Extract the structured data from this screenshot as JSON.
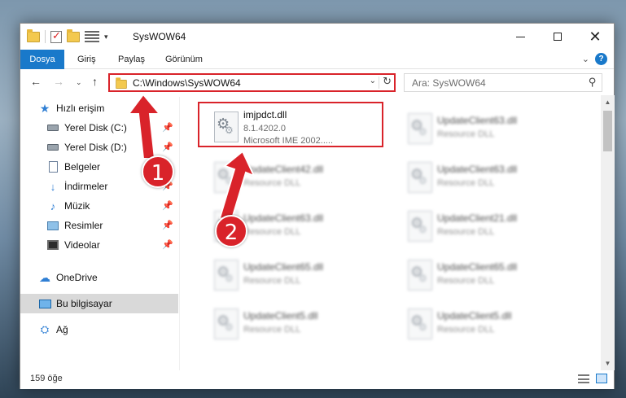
{
  "window": {
    "title": "SysWOW64",
    "minimize_icon": "minimize-icon",
    "maximize_icon": "maximize-icon",
    "close_icon": "close-icon",
    "close_glyph": "✕"
  },
  "ribbon": {
    "tabs": [
      {
        "label": "Dosya",
        "active": true
      },
      {
        "label": "Giriş"
      },
      {
        "label": "Paylaş"
      },
      {
        "label": "Görünüm"
      }
    ],
    "collapse_glyph": "⌄",
    "help_glyph": "?"
  },
  "nav": {
    "back_glyph": "←",
    "forward_glyph": "→",
    "history_glyph": "⌄",
    "up_glyph": "↑",
    "address": "C:\\Windows\\SysWOW64",
    "address_dropdown_glyph": "⌄",
    "refresh_glyph": "↻",
    "search_placeholder": "Ara: SysWOW64",
    "search_glyph": "⚲"
  },
  "sidebar": {
    "items": [
      {
        "label": "Hızlı erişim",
        "icon": "star-icon"
      },
      {
        "label": "Yerel Disk (C:)",
        "icon": "drive-icon",
        "pinned": true
      },
      {
        "label": "Yerel Disk (D:)",
        "icon": "drive-icon",
        "pinned": true
      },
      {
        "label": "Belgeler",
        "icon": "document-icon"
      },
      {
        "label": "İndirmeler",
        "icon": "download-icon",
        "pinned": true
      },
      {
        "label": "Müzik",
        "icon": "music-icon",
        "pinned": true
      },
      {
        "label": "Resimler",
        "icon": "pictures-icon",
        "pinned": true
      },
      {
        "label": "Videolar",
        "icon": "video-icon",
        "pinned": true
      },
      {
        "label": "OneDrive",
        "icon": "cloud-icon"
      },
      {
        "label": "Bu bilgisayar",
        "icon": "computer-icon",
        "selected": true
      },
      {
        "label": "Ağ",
        "icon": "network-icon"
      }
    ],
    "pin_glyph": "📌"
  },
  "files": [
    {
      "name": "imjpdct.dll",
      "version": "8.1.4202.0",
      "description": "Microsoft IME 2002.....",
      "highlighted": true
    },
    {
      "name": "UpdateClient63.dll",
      "type": "Resource DLL",
      "blurred": true
    },
    {
      "name": "UpdateClient42.dll",
      "type": "Resource DLL",
      "blurred": true
    },
    {
      "name": "UpdateClient63.dll",
      "type": "Resource DLL",
      "blurred": true
    },
    {
      "name": "UpdateClient63.dll",
      "type": "Resource DLL",
      "blurred": true
    },
    {
      "name": "UpdateClient21.dll",
      "type": "Resource DLL",
      "blurred": true
    },
    {
      "name": "UpdateClient65.dll",
      "type": "Resource DLL",
      "blurred": true
    },
    {
      "name": "UpdateClient65.dll",
      "type": "Resource DLL",
      "blurred": true
    },
    {
      "name": "UpdateClient5.dll",
      "type": "Resource DLL",
      "blurred": true
    },
    {
      "name": "UpdateClient5.dll",
      "type": "Resource DLL",
      "blurred": true
    }
  ],
  "scrollbar": {
    "up_glyph": "▲",
    "down_glyph": "▼"
  },
  "status": {
    "item_count": "159 öğe"
  },
  "annotations": {
    "callout_1": "1",
    "callout_2": "2",
    "color": "#d9232a"
  }
}
